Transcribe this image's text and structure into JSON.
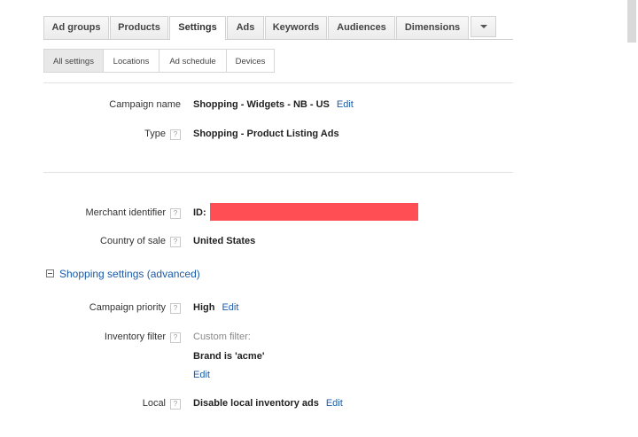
{
  "tabs": {
    "items": [
      "Ad groups",
      "Products",
      "Settings",
      "Ads",
      "Keywords",
      "Audiences",
      "Dimensions"
    ],
    "active": "Settings"
  },
  "subtabs": {
    "items": [
      "All settings",
      "Locations",
      "Ad schedule",
      "Devices"
    ],
    "active": "All settings"
  },
  "help_glyph": "?",
  "campaign": {
    "name_label": "Campaign name",
    "name_value": "Shopping - Widgets - NB - US",
    "type_label": "Type",
    "type_value": "Shopping - Product Listing Ads"
  },
  "merchant": {
    "id_label": "Merchant identifier",
    "id_prefix": "ID:",
    "country_label": "Country of sale",
    "country_value": "United States"
  },
  "shopping_settings": {
    "title": "Shopping settings (advanced)",
    "priority_label": "Campaign priority",
    "priority_value": "High",
    "inventory_label": "Inventory filter",
    "inventory_caption": "Custom filter:",
    "inventory_value": "Brand is 'acme'",
    "local_label": "Local",
    "local_value": "Disable local inventory ads"
  },
  "edit_label": "Edit",
  "colors": {
    "link": "#1a5aa8",
    "redaction": "#ff4f55"
  }
}
